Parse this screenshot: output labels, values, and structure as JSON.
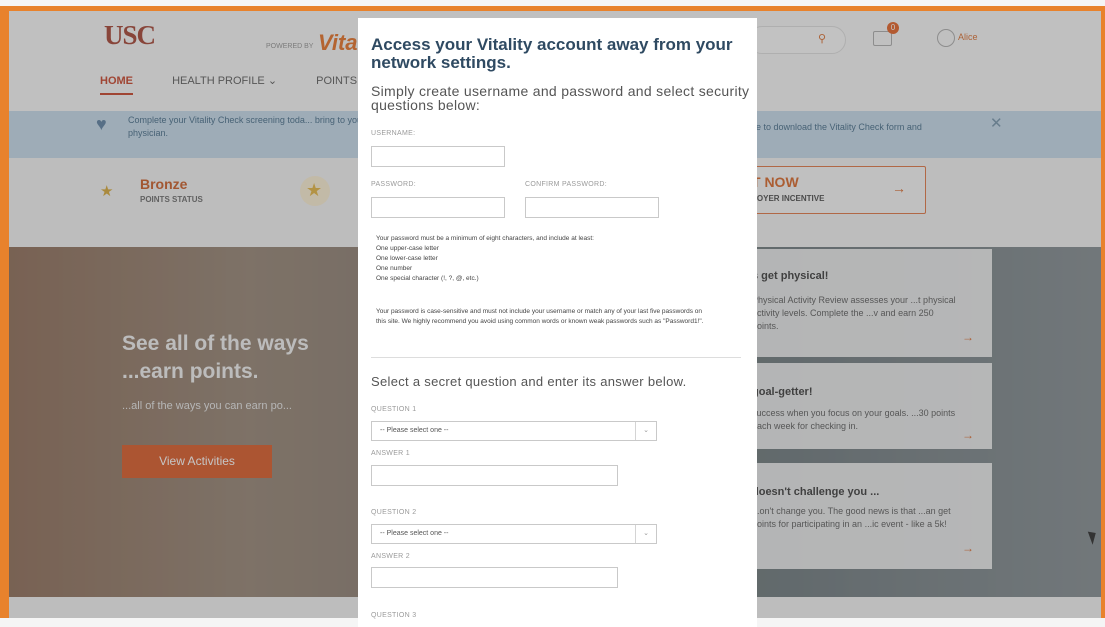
{
  "background": {
    "logo": "USC",
    "powered_by": "POWERED BY",
    "vitality_partial": "Vita",
    "user_name": "Alice",
    "notification_count": "0",
    "nav": [
      "HOME",
      "HEALTH PROFILE ⌄",
      "POINTS"
    ],
    "banner_left": "Complete your Vitality Check screening toda... bring to your physician.",
    "banner_right": "ere to download the Vitality Check form and",
    "status_title": "Bronze",
    "status_sub": "POINTS STATUS",
    "incentive_now": "T NOW",
    "incentive_sub": "LOYER INCENTIVE",
    "hero_title": "See all of the ways ...earn points.",
    "hero_sub": "...all of the ways you can earn po...",
    "hero_button": "View Activities",
    "cards": [
      {
        "title": "s get physical!",
        "text": "Physical Activity Review assesses your ...t physical activity levels. Complete the ...v and earn 250 points."
      },
      {
        "title": "goal-getter!",
        "text": "success when you focus on your goals. ...30 points each week for checking in."
      },
      {
        "title": "doesn't challenge you ...",
        "text": "...on't change you. The good news is that ...an get points for participating in an ...ic event - like a 5k!"
      }
    ]
  },
  "modal": {
    "title": "Access your Vitality account away from your network settings.",
    "subtitle": "Simply create username and password and select security questions below:",
    "username_label": "USERNAME:",
    "password_label": "PASSWORD:",
    "confirm_label": "CONFIRM PASSWORD:",
    "rules": [
      "Your password must be a minimum of eight characters, and include at least:",
      "One upper-case letter",
      "One lower-case letter",
      "One number",
      "One special character (!, ?, @, etc.)"
    ],
    "rules_note": "Your password is case-sensitive and must not include your username or match any of your last five passwords on this site. We highly recommend you avoid using common words or known weak passwords such as \"Password1!\".",
    "section_title": "Select a secret question and enter its answer below.",
    "question1_label": "QUESTION 1",
    "answer1_label": "ANSWER 1",
    "question2_label": "QUESTION 2",
    "answer2_label": "ANSWER 2",
    "question3_label": "QUESTION 3",
    "select_placeholder": "-- Please select one --"
  }
}
